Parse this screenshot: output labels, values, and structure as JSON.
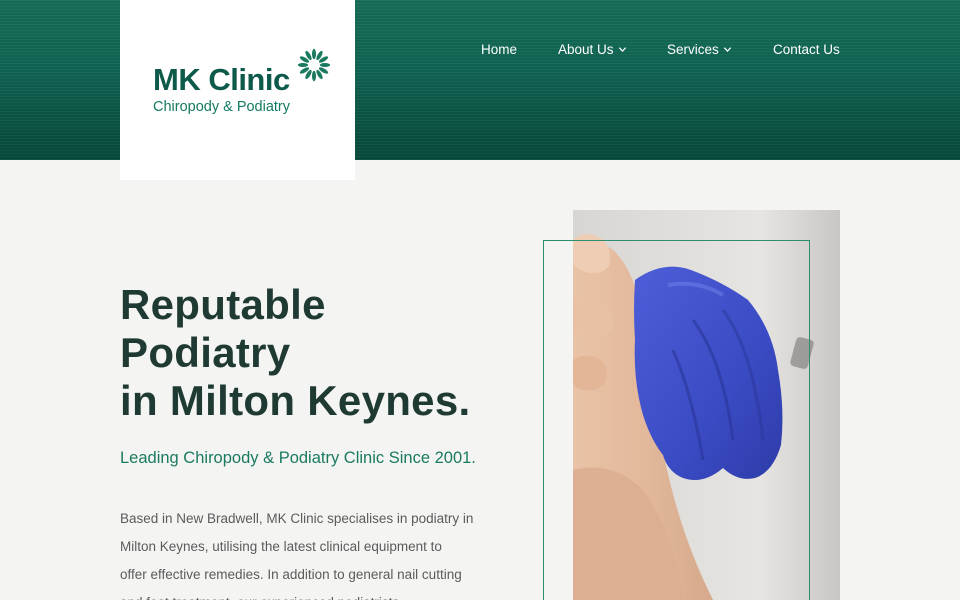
{
  "brand": {
    "name": "MK Clinic",
    "tagline": "Chiropody & Podiatry",
    "logo_icon": "sunburst-icon",
    "colors": {
      "primary_green": "#0d5a4b",
      "accent_green": "#1a7a60",
      "header_green": "#0f6150",
      "background": "#f4f4f3"
    }
  },
  "nav": {
    "items": [
      {
        "label": "Home",
        "has_dropdown": false
      },
      {
        "label": "About Us",
        "has_dropdown": true
      },
      {
        "label": "Services",
        "has_dropdown": true
      },
      {
        "label": "Contact Us",
        "has_dropdown": false
      }
    ]
  },
  "hero": {
    "title_lines": [
      "Reputable",
      "Podiatry",
      "in Milton Keynes."
    ],
    "tagline": "Leading Chiropody & Podiatry Clinic Since 2001.",
    "body_lines": [
      "Based in New Bradwell, MK Clinic specialises in podiatry in",
      "Milton Keynes, utilising the latest clinical equipment to",
      "offer effective remedies. In addition to general nail cutting",
      "and foot treatment, our experienced podiatrists"
    ],
    "image_subject": "gloved-hand-examining-foot-photo"
  }
}
